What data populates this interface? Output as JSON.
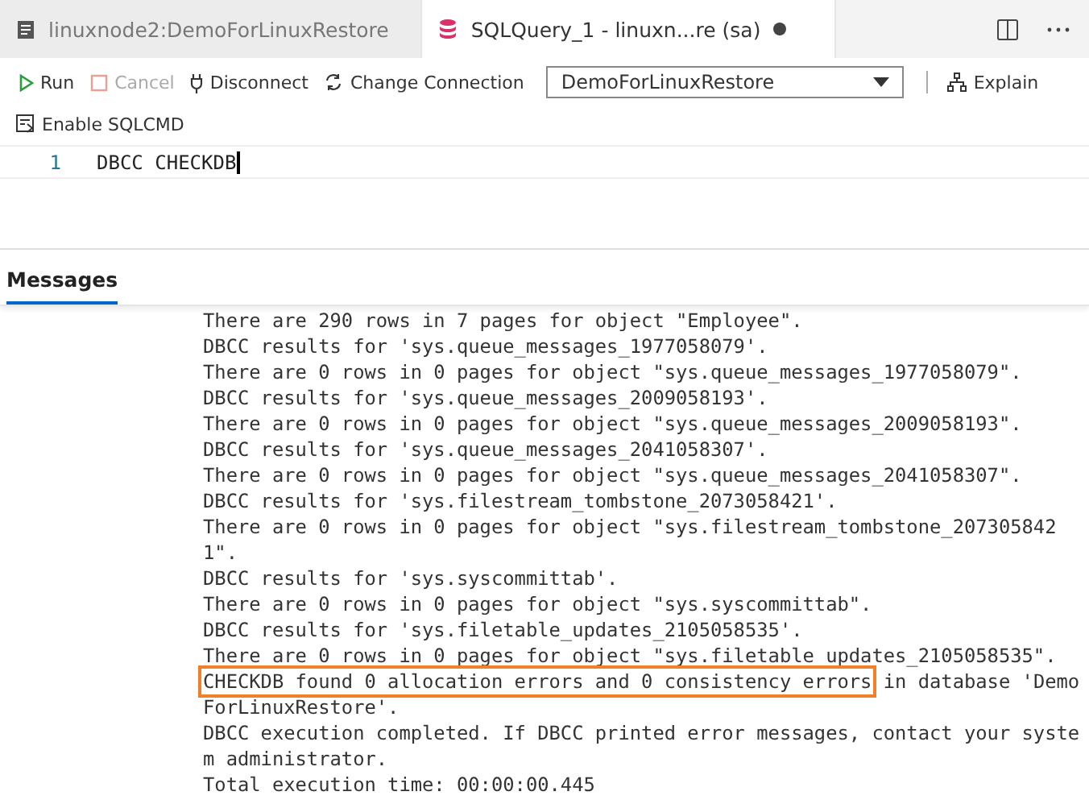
{
  "tabs": [
    {
      "label": "linuxnode2:DemoForLinuxRestore",
      "kind": "document",
      "selected": false,
      "dirty": false
    },
    {
      "label": "SQLQuery_1 - linuxn...re (sa)",
      "kind": "database",
      "selected": true,
      "dirty": true
    }
  ],
  "toolbar": {
    "buttons": [
      {
        "kind": "run",
        "label": "Run",
        "disabled": false
      },
      {
        "kind": "cancel",
        "label": "Cancel",
        "disabled": true
      },
      {
        "kind": "disconnect",
        "label": "Disconnect",
        "disabled": false
      },
      {
        "kind": "change",
        "label": "Change Connection",
        "disabled": false
      }
    ],
    "database": "DemoForLinuxRestore",
    "explain": "Explain",
    "sqlcmd": "Enable SQLCMD"
  },
  "editor": {
    "lines": [
      {
        "number": "1",
        "code": "DBCC CHECKDB"
      }
    ]
  },
  "results": {
    "tabs": [
      {
        "label": "Messages",
        "selected": true
      }
    ],
    "lines": [
      {
        "text": "There are 290 rows in 7 pages for object \"Employee\"."
      },
      {
        "text": "DBCC results for 'sys.queue_messages_1977058079'."
      },
      {
        "text": "There are 0 rows in 0 pages for object \"sys.queue_messages_1977058079\"."
      },
      {
        "text": "DBCC results for 'sys.queue_messages_2009058193'."
      },
      {
        "text": "There are 0 rows in 0 pages for object \"sys.queue_messages_2009058193\"."
      },
      {
        "text": "DBCC results for 'sys.queue_messages_2041058307'."
      },
      {
        "text": "There are 0 rows in 0 pages for object \"sys.queue_messages_2041058307\"."
      },
      {
        "text": "DBCC results for 'sys.filestream_tombstone_2073058421'."
      },
      {
        "text": "There are 0 rows in 0 pages for object \"sys.filestream_tombstone_207305842"
      },
      {
        "text": "1\"."
      },
      {
        "text": "DBCC results for 'sys.syscommittab'."
      },
      {
        "text": "There are 0 rows in 0 pages for object \"sys.syscommittab\"."
      },
      {
        "text": "DBCC results for 'sys.filetable_updates_2105058535'."
      },
      {
        "text": "There are 0 rows in 0 pages for object \"sys.filetable_updates_2105058535\"."
      },
      {
        "text": " in database 'Demo",
        "boxed": "CHECKDB found 0 allocation errors and 0 consistency errors"
      },
      {
        "text": "ForLinuxRestore'."
      },
      {
        "text": "DBCC execution completed. If DBCC printed error messages, contact your syste"
      },
      {
        "text": "m administrator."
      },
      {
        "text": "Total execution time: 00:00:00.445"
      }
    ]
  }
}
